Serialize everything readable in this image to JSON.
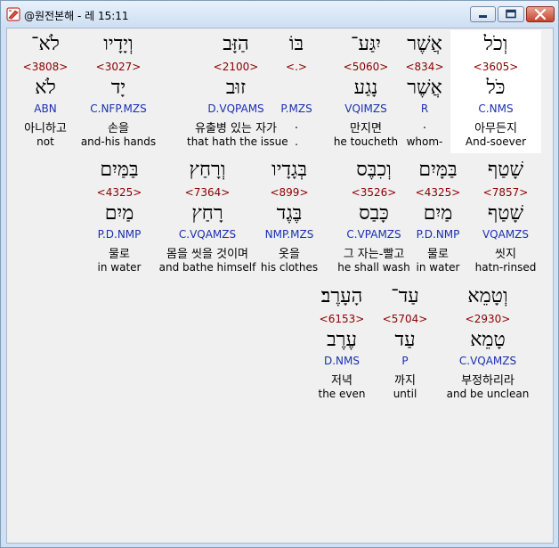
{
  "window": {
    "title": "@원전본해 - 레 15:11",
    "min_icon": "minimize-icon",
    "max_icon": "maximize-icon",
    "close_icon": "close-icon"
  },
  "rows": [
    [
      {
        "heb": "וְכֹל",
        "ref": "<3605>",
        "lem": "כֹּל",
        "morph": "C.NMS",
        "kor": "아무든지",
        "eng": "And-soever",
        "selected": true
      },
      {
        "heb": "אֲשֶׁר",
        "ref": "<834>",
        "lem": "אֲשֶׁר",
        "morph": "R",
        "kor": ".",
        "eng": "whom-",
        "selected": false
      },
      {
        "heb": "יִגַּע־",
        "ref": "<5060>",
        "lem": "נָגַע",
        "morph": "VQIMZS",
        "kor": "만지면",
        "eng": "he toucheth",
        "selected": false
      },
      {
        "heb": "בּוֹ",
        "ref": "<.>",
        "lem": "",
        "morph": "P.MZS",
        "kor": ".",
        "eng": ".",
        "selected": false
      },
      {
        "heb": "הַזָּב",
        "ref": "<2100>",
        "lem": "זוּב",
        "morph": "D.VQPAMS",
        "kor": "유출병 있는 자가",
        "eng": "that hath the issue",
        "selected": false
      },
      {
        "heb": "וְיָדָיו",
        "ref": "<3027>",
        "lem": "יָד",
        "morph": "C.NFP.MZS",
        "kor": "손을",
        "eng": "and-his hands",
        "selected": false
      },
      {
        "heb": "לֹא־",
        "ref": "<3808>",
        "lem": "לֹא",
        "morph": "ABN",
        "kor": "아니하고",
        "eng": "not",
        "selected": false
      }
    ],
    [
      {
        "heb": "שָׁטַף",
        "ref": "<7857>",
        "lem": "שָׁטַף",
        "morph": "VQAMZS",
        "kor": "씻지",
        "eng": "hatn-rinsed",
        "selected": false
      },
      {
        "heb": "בַּמָּיִם",
        "ref": "<4325>",
        "lem": "מַיִם",
        "morph": "P.D.NMP",
        "kor": "물로",
        "eng": "in water",
        "selected": false
      },
      {
        "heb": "וְכִבֶּס",
        "ref": "<3526>",
        "lem": "כָּבַס",
        "morph": "C.VPAMZS",
        "kor": "그 자는-빨고",
        "eng": "he shall wash",
        "selected": false
      },
      {
        "heb": "בְּגָדָיו",
        "ref": "<899>",
        "lem": "בֶּגֶד",
        "morph": "NMP.MZS",
        "kor": "옷을",
        "eng": "his clothes",
        "selected": false
      },
      {
        "heb": "וְרָחַץ",
        "ref": "<7364>",
        "lem": "רָחַץ",
        "morph": "C.VQAMZS",
        "kor": "몸을 씻을 것이며",
        "eng": "and bathe himself",
        "selected": false
      },
      {
        "heb": "בַּמַּיִם",
        "ref": "<4325>",
        "lem": "מַיִם",
        "morph": "P.D.NMP",
        "kor": "물로",
        "eng": "in water",
        "selected": false
      }
    ],
    [
      {
        "heb": "וְטָמֵא",
        "ref": "<2930>",
        "lem": "טָמֵא",
        "morph": "C.VQAMZS",
        "kor": "부정하리라",
        "eng": "and be unclean",
        "selected": false
      },
      {
        "heb": "עַד־",
        "ref": "<5704>",
        "lem": "עַד",
        "morph": "P",
        "kor": "까지",
        "eng": "until",
        "selected": false
      },
      {
        "heb": "הָעָרֶב׃",
        "ref": "<6153>",
        "lem": "עֶרֶב",
        "morph": "D.NMS",
        "kor": "저녁",
        "eng": "the even",
        "selected": false
      }
    ]
  ]
}
